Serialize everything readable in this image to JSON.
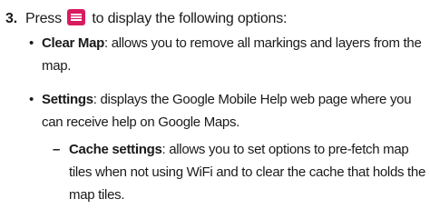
{
  "step": {
    "number": "3.",
    "before_icon": "Press",
    "icon": "menu-key-icon",
    "after_icon": "to display the following options:"
  },
  "items": [
    {
      "term": "Clear Map",
      "description": ": allows you to remove all markings and layers from the map."
    },
    {
      "term": "Settings",
      "description": ": displays the Google Mobile Help web page where you can receive help on Google Maps."
    }
  ],
  "subitems": [
    {
      "term": "Cache settings",
      "description": ": allows you to set options to pre-fetch map tiles when not using WiFi and to clear the cache that holds the map tiles."
    }
  ],
  "colors": {
    "menu_key": "#d81b60"
  }
}
